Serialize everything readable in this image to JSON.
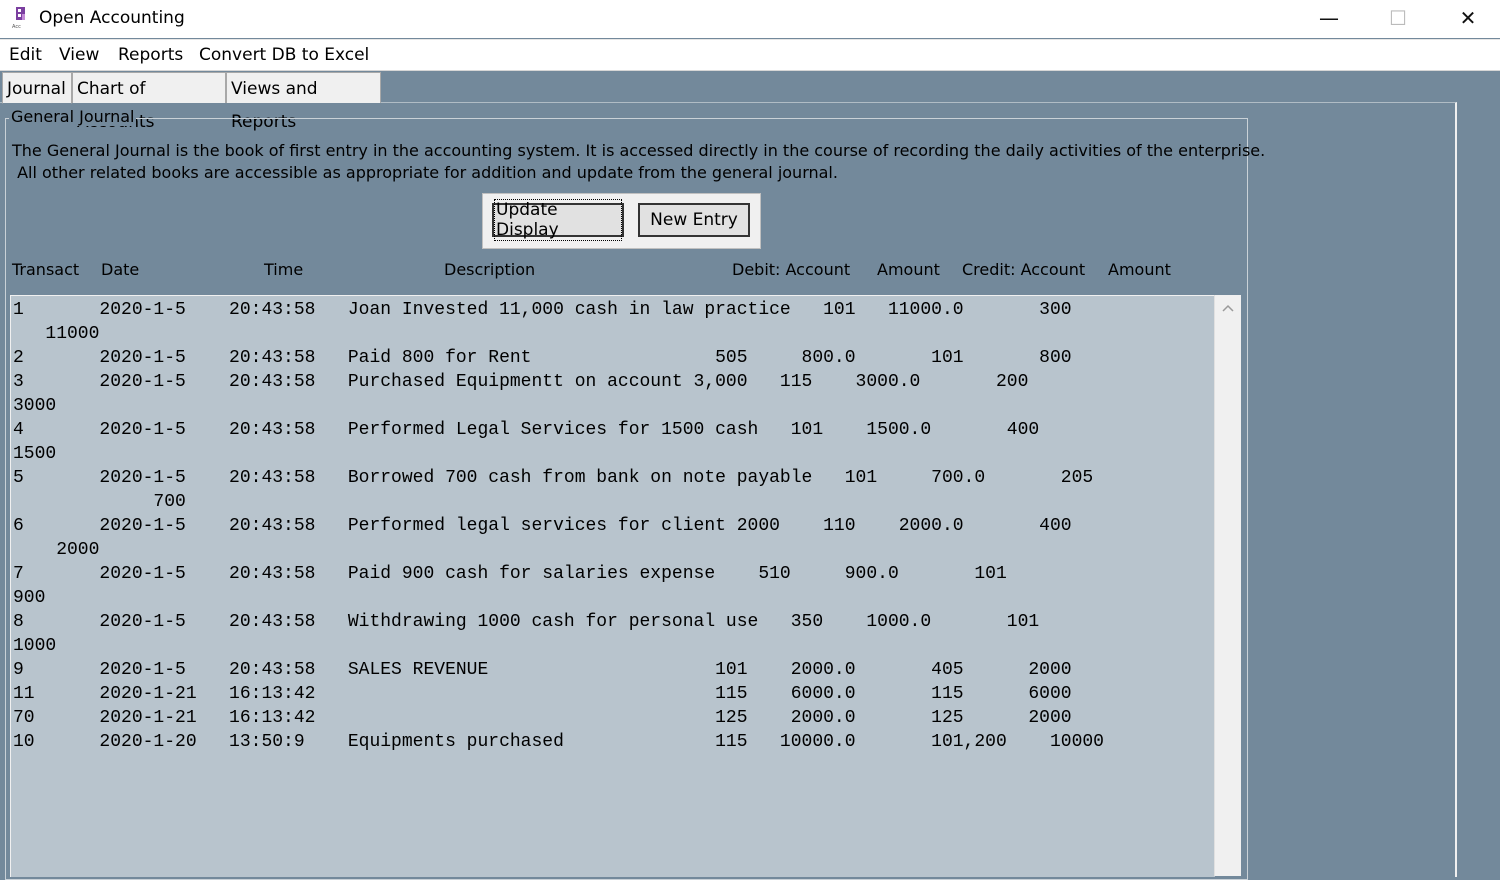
{
  "window": {
    "title": "Open Accounting",
    "minimize_glyph": "—",
    "maximize_glyph": "☐",
    "close_glyph": "✕"
  },
  "menu": [
    "Edit",
    "View",
    "Reports",
    "Convert DB to Excel"
  ],
  "tabs": [
    "Journal",
    "Chart of Accounts",
    "Views and Reports"
  ],
  "group": {
    "title": "General Journal",
    "description_line1": "The General Journal is the book of first entry in the accounting system. It is accessed directly in the course of recording the daily activities of the enterprise.",
    "description_line2": " All other related books are accessible as appropriate for addition and update from the general journal."
  },
  "buttons": {
    "update_display": "Update Display",
    "new_entry": "New Entry"
  },
  "columns": {
    "transact": "Transact",
    "date": "Date",
    "time": "Time",
    "description": "Description",
    "debit_account": "Debit:  Account",
    "debit_amount": "Amount",
    "credit_account": "Credit:  Account",
    "credit_amount": "Amount"
  },
  "journal_lines": [
    "1       2020-1-5    20:43:58   Joan Invested 11,000 cash in law practice   101   11000.0       300",
    "   11000",
    "2       2020-1-5    20:43:58   Paid 800 for Rent                 505     800.0       101       800",
    "3       2020-1-5    20:43:58   Purchased Equipmentt on account 3,000   115    3000.0       200",
    "3000",
    "4       2020-1-5    20:43:58   Performed Legal Services for 1500 cash   101    1500.0       400",
    "1500",
    "5       2020-1-5    20:43:58   Borrowed 700 cash from bank on note payable   101     700.0       205",
    "             700",
    "6       2020-1-5    20:43:58   Performed legal services for client 2000    110    2000.0       400",
    "    2000",
    "7       2020-1-5    20:43:58   Paid 900 cash for salaries expense    510     900.0       101",
    "900",
    "8       2020-1-5    20:43:58   Withdrawing 1000 cash for personal use   350    1000.0       101",
    "1000",
    "9       2020-1-5    20:43:58   SALES REVENUE                     101    2000.0       405      2000",
    "11      2020-1-21   16:13:42                                     115    6000.0       115      6000",
    "70      2020-1-21   16:13:42                                     125    2000.0       125      2000",
    "10      2020-1-20   13:50:9    Equipments purchased              115   10000.0       101,200    10000"
  ],
  "colors": {
    "background": "#73899b",
    "list_background": "#b8c4cd",
    "app_icon": "#7b3fa0"
  },
  "icons": {
    "app": "app-logo-icon",
    "scroll_up": "chevron-up-icon"
  }
}
